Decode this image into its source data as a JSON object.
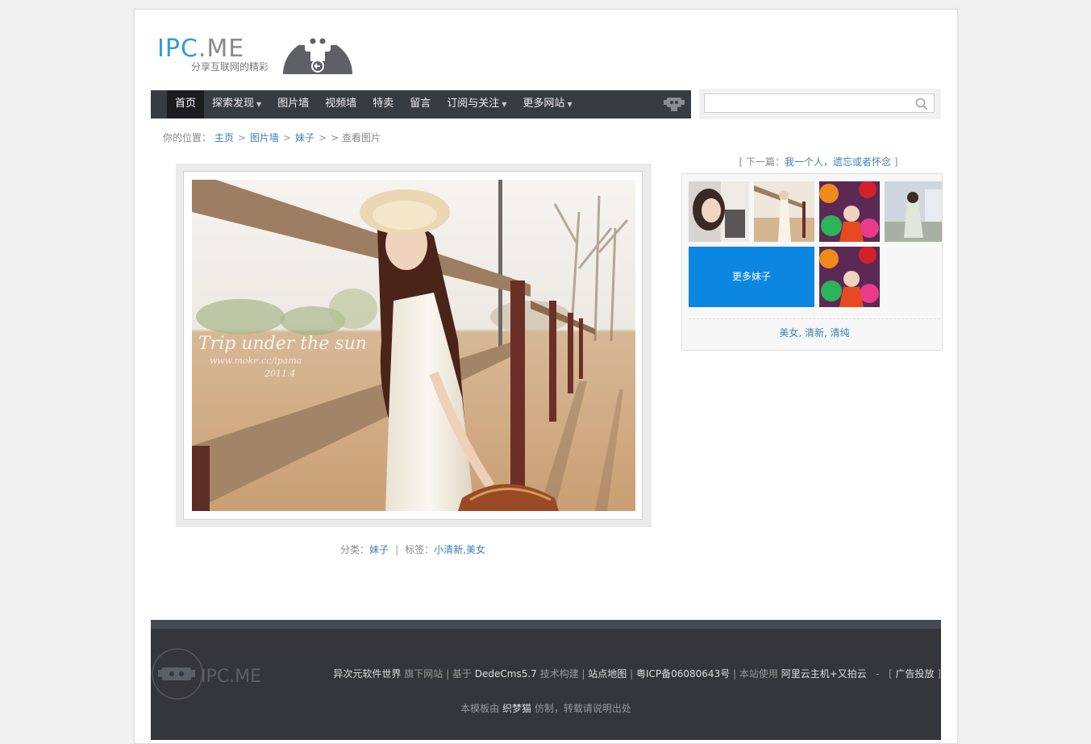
{
  "site": {
    "logo_main": "IPC",
    "logo_rest": ".ME",
    "slogan": "分享互联网的精彩"
  },
  "nav": {
    "items": [
      {
        "label": "首页",
        "active": true
      },
      {
        "label": "探索发现",
        "dropdown": true
      },
      {
        "label": "图片墙"
      },
      {
        "label": "视频墙"
      },
      {
        "label": "特卖"
      },
      {
        "label": "留言"
      },
      {
        "label": "订阅与关注",
        "dropdown": true
      },
      {
        "label": "更多网站",
        "dropdown": true
      }
    ]
  },
  "search": {
    "placeholder": ""
  },
  "breadcrumb": {
    "prefix": "你的位置：",
    "home": "主页",
    "gallery": "图片墙",
    "category": "妹子",
    "tail": "> 查看图片"
  },
  "photo": {
    "overlay_title": "Trip under the sun",
    "overlay_sub": "www.moke.cc/ipama",
    "overlay_date": "2011.4"
  },
  "meta": {
    "category_label": "分类：",
    "category_value": "妹子",
    "tags_label": "标签：",
    "tags_value": "小清新,美女"
  },
  "sidebar": {
    "next_prefix": "[ 下一篇：",
    "next_title": "我一个人，遗忘或者怀念",
    "next_suffix": " ]",
    "more_label": "更多妹子",
    "tags": "美女, 清新, 清纯"
  },
  "footer": {
    "brand": "异次元软件世界",
    "t1": " 旗下网站 | 基于 ",
    "cms": "DedeCms5.7",
    "t2": " 技术构建 | ",
    "sitemap": "站点地图",
    "t3": " | ",
    "icp": "粤ICP备06080643号",
    "t4": " | 本站使用 ",
    "host": "阿里云主机+又拍云",
    "t5": "   -   [ ",
    "ads": "广告投放",
    "t6": " ]",
    "l2_a": "本模板由 ",
    "author": "织梦猫",
    "l2_b": " 仿制，转载请说明出处",
    "logo_text": "IPC.ME"
  },
  "colors": {
    "accent": "#2b9ed8",
    "nav_bg": "#373b42",
    "more_blue": "#0c87e1",
    "footer_bg": "#34363b"
  }
}
